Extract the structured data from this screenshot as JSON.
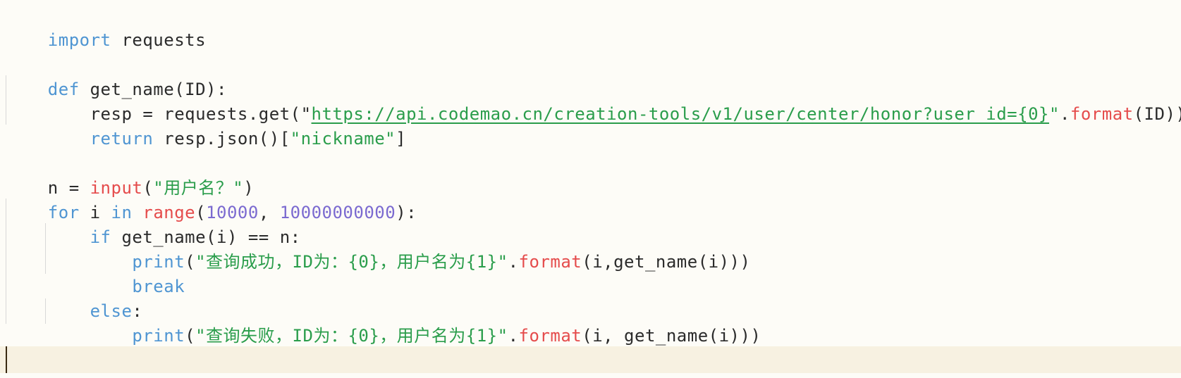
{
  "code": {
    "line1": [
      "import",
      " requests"
    ],
    "line3": [
      "def",
      " get_name(ID):"
    ],
    "line4": [
      "    resp = requests.get(\"",
      "https://api.codemao.cn/creation-tools/v1/user/center/honor?user_id={0}",
      "\"",
      ".",
      "format",
      "(ID))"
    ],
    "line5": [
      "    ",
      "return",
      " resp.json()[",
      "\"nickname\"",
      "]"
    ],
    "line7": [
      "n = ",
      "input",
      "(",
      "\"用户名？\"",
      ")"
    ],
    "line8": [
      "for",
      " i ",
      "in",
      " ",
      "range",
      "(",
      "10000",
      ", ",
      "10000000000",
      "):"
    ],
    "line9": [
      "    ",
      "if",
      " get_name(i) == n:"
    ],
    "line10": [
      "        ",
      "print",
      "(",
      "\"查询成功，ID为：{0}，用户名为{1}\"",
      ".",
      "format",
      "(i,get_name(i)))"
    ],
    "line11": [
      "        ",
      "break"
    ],
    "line12": [
      "    ",
      "else",
      ":"
    ],
    "line13": [
      "        ",
      "print",
      "(",
      "\"查询失败，ID为：{0}，用户名为{1}\"",
      ".",
      "format",
      "(i, get_name(i)))"
    ]
  },
  "colors": {
    "keyword": "#4f95d2",
    "builtin": "#e54c4c",
    "string": "#2a9d4b",
    "number": "#7b6ad0",
    "background": "#fdfcf7",
    "current_line": "#f7f1e1"
  }
}
